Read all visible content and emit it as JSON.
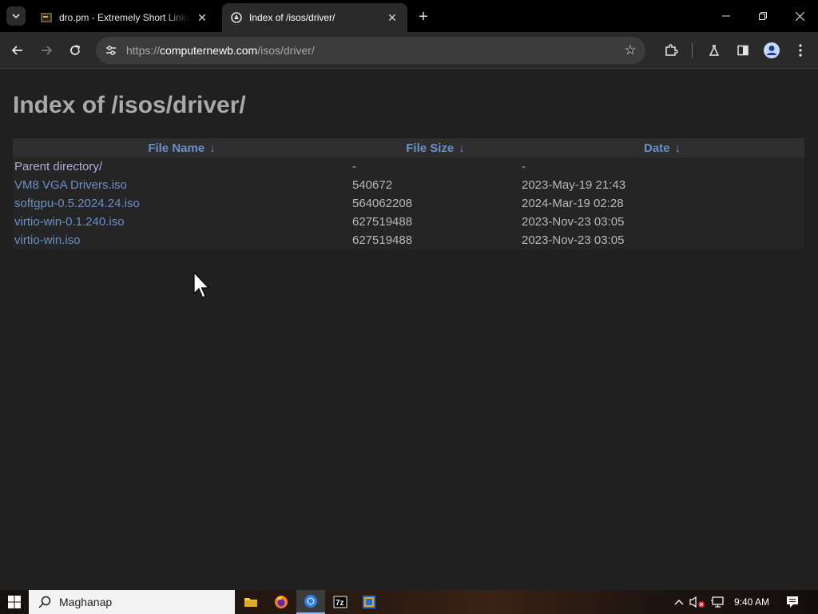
{
  "browser": {
    "tabs": [
      {
        "title": "dro.pm - Extremely Short Links",
        "active": false
      },
      {
        "title": "Index of /isos/driver/",
        "active": true
      }
    ],
    "new_tab_label": "+",
    "url_scheme": "https://",
    "url_host": "computernewb.com",
    "url_path": "/isos/driver/"
  },
  "page": {
    "title": "Index of /isos/driver/",
    "columns": [
      {
        "label": "File Name",
        "sort_arrow": "↓"
      },
      {
        "label": "File Size",
        "sort_arrow": "↓"
      },
      {
        "label": "Date",
        "sort_arrow": "↓"
      }
    ],
    "rows": [
      {
        "name": "Parent directory/",
        "size": "-",
        "date": "-"
      },
      {
        "name": "VM8 VGA Drivers.iso",
        "size": "540672",
        "date": "2023-May-19 21:43"
      },
      {
        "name": "softgpu-0.5.2024.24.iso",
        "size": "564062208",
        "date": "2024-Mar-19 02:28"
      },
      {
        "name": "virtio-win-0.1.240.iso",
        "size": "627519488",
        "date": "2023-Nov-23 03:05"
      },
      {
        "name": "virtio-win.iso",
        "size": "627519488",
        "date": "2023-Nov-23 03:05"
      }
    ],
    "link_color": "#6b8fc9",
    "background_color": "#202020"
  },
  "taskbar": {
    "search_placeholder": "Maghanap",
    "clock": "9:40 AM"
  }
}
